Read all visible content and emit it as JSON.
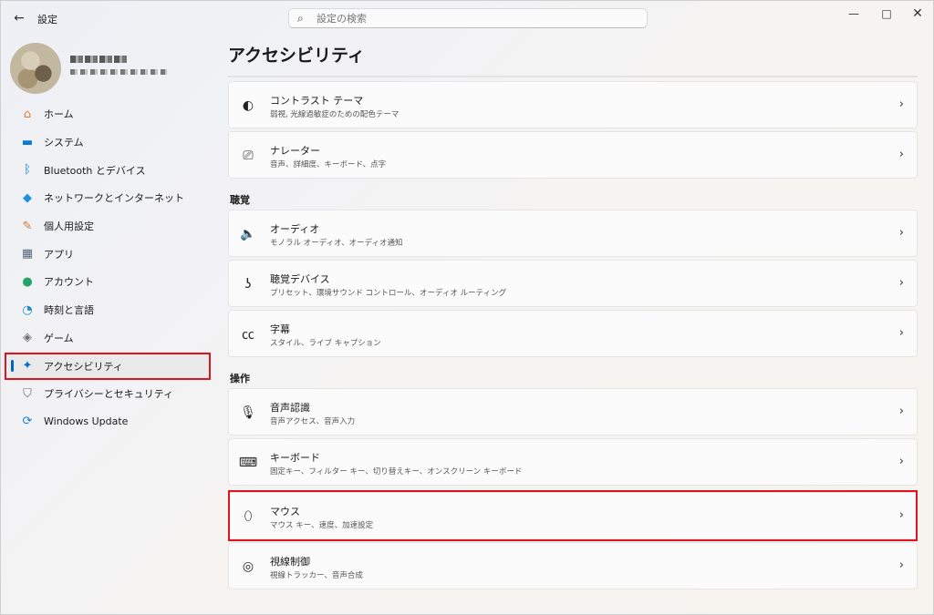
{
  "window": {
    "title": "設定",
    "back_glyph": "←",
    "minimize_glyph": "—",
    "maximize_glyph": "□",
    "close_glyph": "✕"
  },
  "search": {
    "placeholder": "設定の検索",
    "icon": "search-icon"
  },
  "sidebar": {
    "items": [
      {
        "label": "ホーム",
        "icon": "home-icon",
        "glyph": "⌂",
        "color": "#e07a2e"
      },
      {
        "label": "システム",
        "icon": "system-icon",
        "glyph": "▬",
        "color": "#0a7bd4"
      },
      {
        "label": "Bluetooth とデバイス",
        "icon": "bluetooth-icon",
        "glyph": "ᛒ",
        "color": "#0a7bd4"
      },
      {
        "label": "ネットワークとインターネット",
        "icon": "wifi-icon",
        "glyph": "◆",
        "color": "#1f8fe0"
      },
      {
        "label": "個人用設定",
        "icon": "brush-icon",
        "glyph": "✎",
        "color": "#c8783a"
      },
      {
        "label": "アプリ",
        "icon": "apps-icon",
        "glyph": "▦",
        "color": "#5a6a7a"
      },
      {
        "label": "アカウント",
        "icon": "account-icon",
        "glyph": "●",
        "color": "#25a36b"
      },
      {
        "label": "時刻と言語",
        "icon": "globe-clock-icon",
        "glyph": "◔",
        "color": "#1a8ad4"
      },
      {
        "label": "ゲーム",
        "icon": "gamepad-icon",
        "glyph": "◈",
        "color": "#707070"
      },
      {
        "label": "アクセシビリティ",
        "icon": "accessibility-icon",
        "glyph": "✦",
        "color": "#0a6ed1",
        "selected": true
      },
      {
        "label": "プライバシーとセキュリティ",
        "icon": "shield-icon",
        "glyph": "⛉",
        "color": "#6b6b6b"
      },
      {
        "label": "Windows Update",
        "icon": "update-icon",
        "glyph": "⟳",
        "color": "#1a7fd6"
      }
    ]
  },
  "main": {
    "title": "アクセシビリティ",
    "sections": [
      {
        "label": ""
      },
      {
        "label": "聴覚"
      },
      {
        "label": "操作"
      }
    ],
    "cards": [
      {
        "title": "コントラスト テーマ",
        "subtitle": "弱視, 光線過敏症のための配色テーマ",
        "icon": "contrast-icon",
        "glyph": "◐"
      },
      {
        "title": "ナレーター",
        "subtitle": "音声、詳細度、キーボード、点字",
        "icon": "narrator-icon",
        "glyph": "⎚"
      },
      {
        "title": "オーディオ",
        "subtitle": "モノラル オーディオ、オーディオ通知",
        "icon": "speaker-icon",
        "glyph": "🔈"
      },
      {
        "title": "聴覚デバイス",
        "subtitle": "プリセット、環境サウンド コントロール、オーディオ ルーティング",
        "icon": "ear-icon",
        "glyph": "ʖ"
      },
      {
        "title": "字幕",
        "subtitle": "スタイル、ライブ キャプション",
        "icon": "captions-icon",
        "glyph": "㏄"
      },
      {
        "title": "音声認識",
        "subtitle": "音声アクセス、音声入力",
        "icon": "microphone-icon",
        "glyph": "🎙"
      },
      {
        "title": "キーボード",
        "subtitle": "固定キー、フィルター キー、切り替えキー、オンスクリーン キーボード",
        "icon": "keyboard-icon",
        "glyph": "⌨"
      },
      {
        "title": "マウス",
        "subtitle": "マウス キー、速度、加速設定",
        "icon": "mouse-icon",
        "glyph": "⬯"
      },
      {
        "title": "視線制御",
        "subtitle": "視線トラッカー、音声合成",
        "icon": "eye-control-icon",
        "glyph": "◎"
      }
    ],
    "chevron": "›"
  },
  "highlight_color": "#e0141e",
  "accent_color": "#0067c0"
}
